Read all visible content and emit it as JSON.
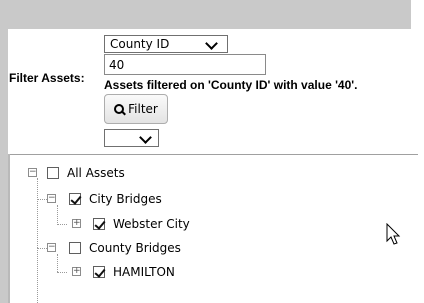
{
  "filter": {
    "label": "Filter Assets:",
    "field_select": {
      "selected": "County ID"
    },
    "value_input": {
      "value": "40"
    },
    "status_message": "Assets filtered on 'County ID' with value '40'.",
    "button_label": "Filter",
    "button_icon": "search-icon",
    "secondary_select": {
      "selected": ""
    }
  },
  "tree": {
    "root": {
      "label": "All Assets",
      "checked": false,
      "expanded": true
    },
    "groups": [
      {
        "label": "City Bridges",
        "checked": true,
        "expanded": true,
        "children": [
          {
            "label": "Webster City",
            "checked": true,
            "expanded": false
          }
        ]
      },
      {
        "label": "County Bridges",
        "checked": false,
        "expanded": true,
        "children": [
          {
            "label": "HAMILTON",
            "checked": true,
            "expanded": false
          }
        ]
      }
    ]
  },
  "colors": {
    "chrome": "#c9c9c9",
    "border": "#a0a0a0"
  }
}
